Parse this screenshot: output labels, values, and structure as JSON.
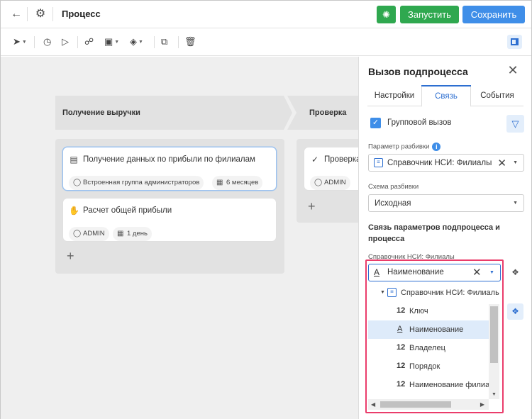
{
  "header": {
    "back_icon": "arrow-left-icon",
    "settings_icon": "gear-icon",
    "title": "Процесс",
    "run_label": "Запустить",
    "save_label": "Сохранить",
    "accent_green": "#2fa84f",
    "accent_blue": "#3f8ee8"
  },
  "toolbar": {
    "tools": [
      "pointer-icon",
      "timer-event-icon",
      "tag-icon",
      "gateway-icon",
      "task-icon",
      "diamond-icon",
      "copy-icon",
      "delete-icon"
    ],
    "panel_toggle_icon": "side-panel-icon"
  },
  "lanes": [
    {
      "title": "Получение выручки",
      "cards": [
        {
          "title": "Получение данных по прибыли по филиалам",
          "owner": "Встроенная группа администраторов",
          "duration": "6 месяцев",
          "selected": true
        },
        {
          "title": "Расчет общей прибыли",
          "owner": "ADMIN",
          "duration": "1 день",
          "selected": false
        }
      ],
      "add_label": "+"
    },
    {
      "title": "Проверка",
      "cards": [
        {
          "title": "Проверка",
          "owner": "ADMIN"
        }
      ],
      "add_label": "+"
    }
  ],
  "panel": {
    "title": "Вызов подпроцесса",
    "tabs": [
      "Настройки",
      "Связь",
      "События"
    ],
    "active_tab": "Связь",
    "group_call_label": "Групповой вызов",
    "group_call_checked": true,
    "split_param_label": "Параметр разбивки",
    "split_param_value": "Справочник НСИ: Филиалы",
    "split_scheme_label": "Схема разбивки",
    "split_scheme_value": "Исходная",
    "link_section_title": "Связь параметров подпроцесса и процесса",
    "mapping_label": "Справочник НСИ: Филиалы",
    "mapping_value": "Наименование",
    "tree_root": "Справочник НСИ: Филиалы",
    "tree_items": [
      {
        "type": "12",
        "label": "Ключ",
        "selected": false
      },
      {
        "type": "A",
        "label": "Наименование",
        "selected": true
      },
      {
        "type": "12",
        "label": "Владелец",
        "selected": false
      },
      {
        "type": "12",
        "label": "Порядок",
        "selected": false
      },
      {
        "type": "12",
        "label": "Наименование филиала",
        "selected": false
      }
    ],
    "highlight_color": "#ea3d6b"
  }
}
